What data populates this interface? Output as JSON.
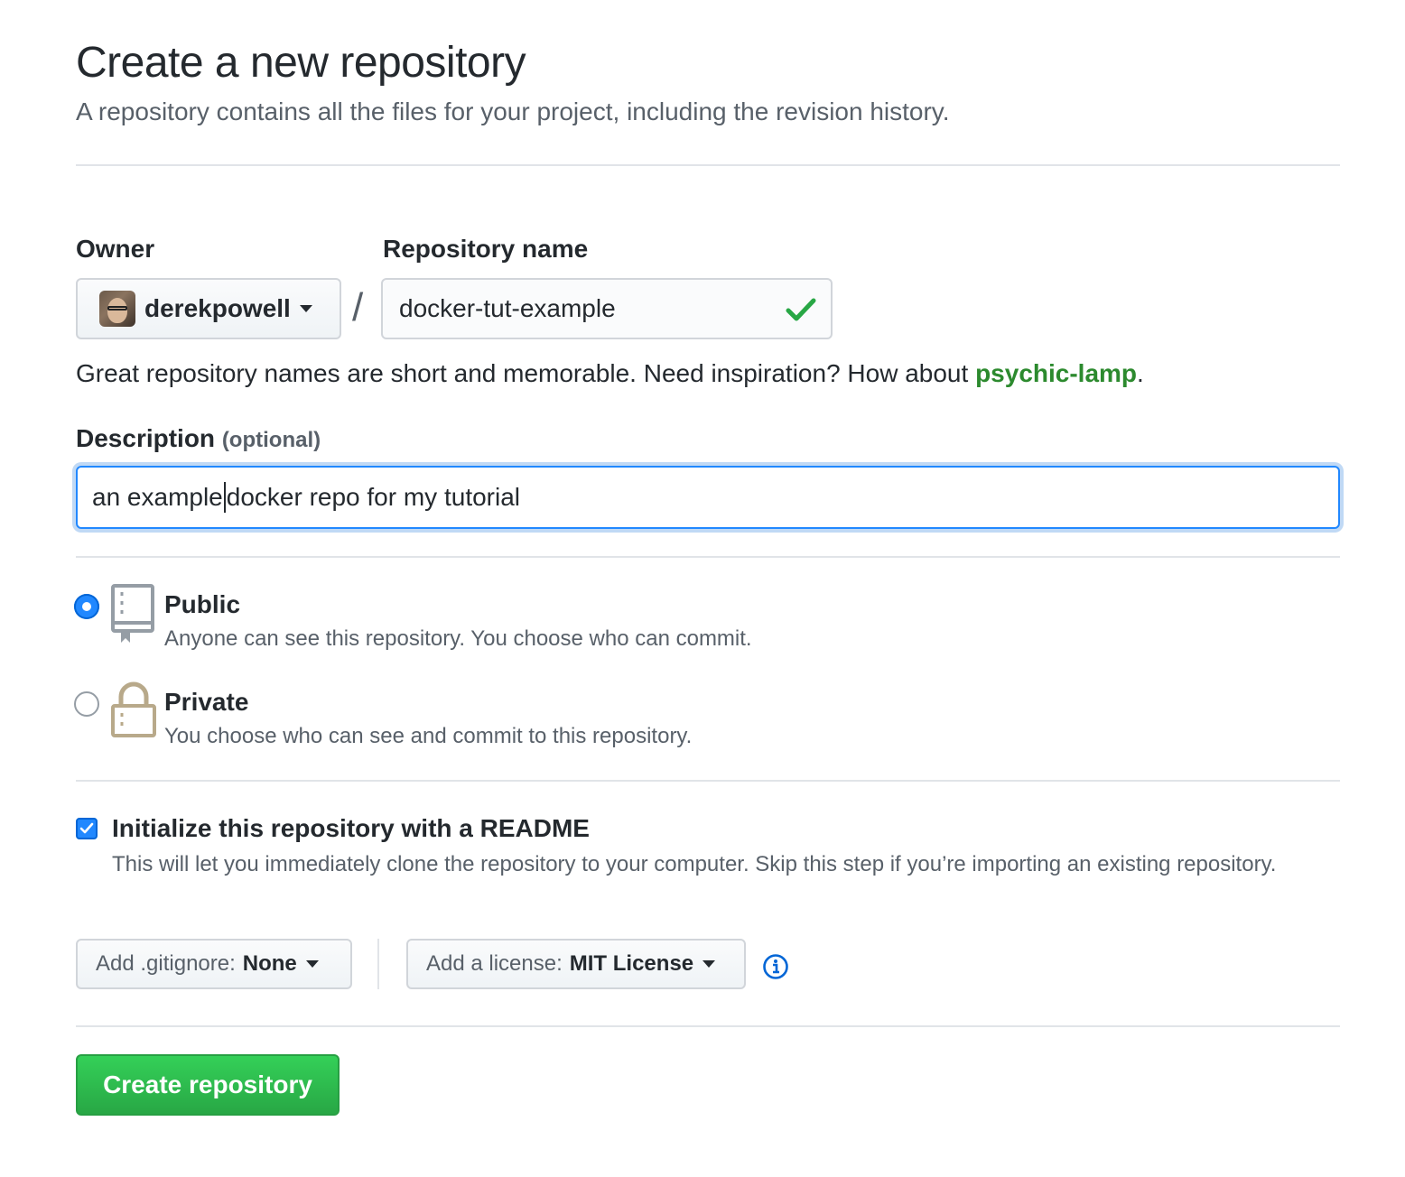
{
  "header": {
    "title": "Create a new repository",
    "subtitle": "A repository contains all the files for your project, including the revision history."
  },
  "owner": {
    "label": "Owner",
    "value": "derekpowell"
  },
  "separator": "/",
  "repository": {
    "label": "Repository name",
    "value": "docker-tut-example"
  },
  "hint": {
    "text": "Great repository names are short and memorable. Need inspiration? How about ",
    "suggestion": "psychic-lamp",
    "end": "."
  },
  "description": {
    "label": "Description",
    "optional": "(optional)",
    "value_before_cursor": "an example",
    "value_after_cursor": "docker repo for my tutorial"
  },
  "visibility": {
    "public": {
      "title": "Public",
      "desc": "Anyone can see this repository. You choose who can commit.",
      "checked": true
    },
    "private": {
      "title": "Private",
      "desc": "You choose who can see and commit to this repository.",
      "checked": false
    }
  },
  "readme": {
    "title": "Initialize this repository with a README",
    "desc": "This will let you immediately clone the repository to your computer. Skip this step if you’re importing an existing repository.",
    "checked": true
  },
  "gitignore": {
    "label": "Add .gitignore:",
    "value": "None"
  },
  "license": {
    "label": "Add a license:",
    "value": "MIT License"
  },
  "submit": {
    "label": "Create repository"
  },
  "icons": {
    "owner_caret": "chevron-down-icon",
    "valid": "check-icon",
    "public": "repo-book-icon",
    "private": "lock-icon",
    "readme_check": "checkbox-check-icon",
    "info": "info-icon"
  },
  "colors": {
    "accent_blue": "#2188ff",
    "success_green": "#28a745",
    "suggestion_green": "#2c8a2e",
    "lock_color": "#b8a98a"
  }
}
